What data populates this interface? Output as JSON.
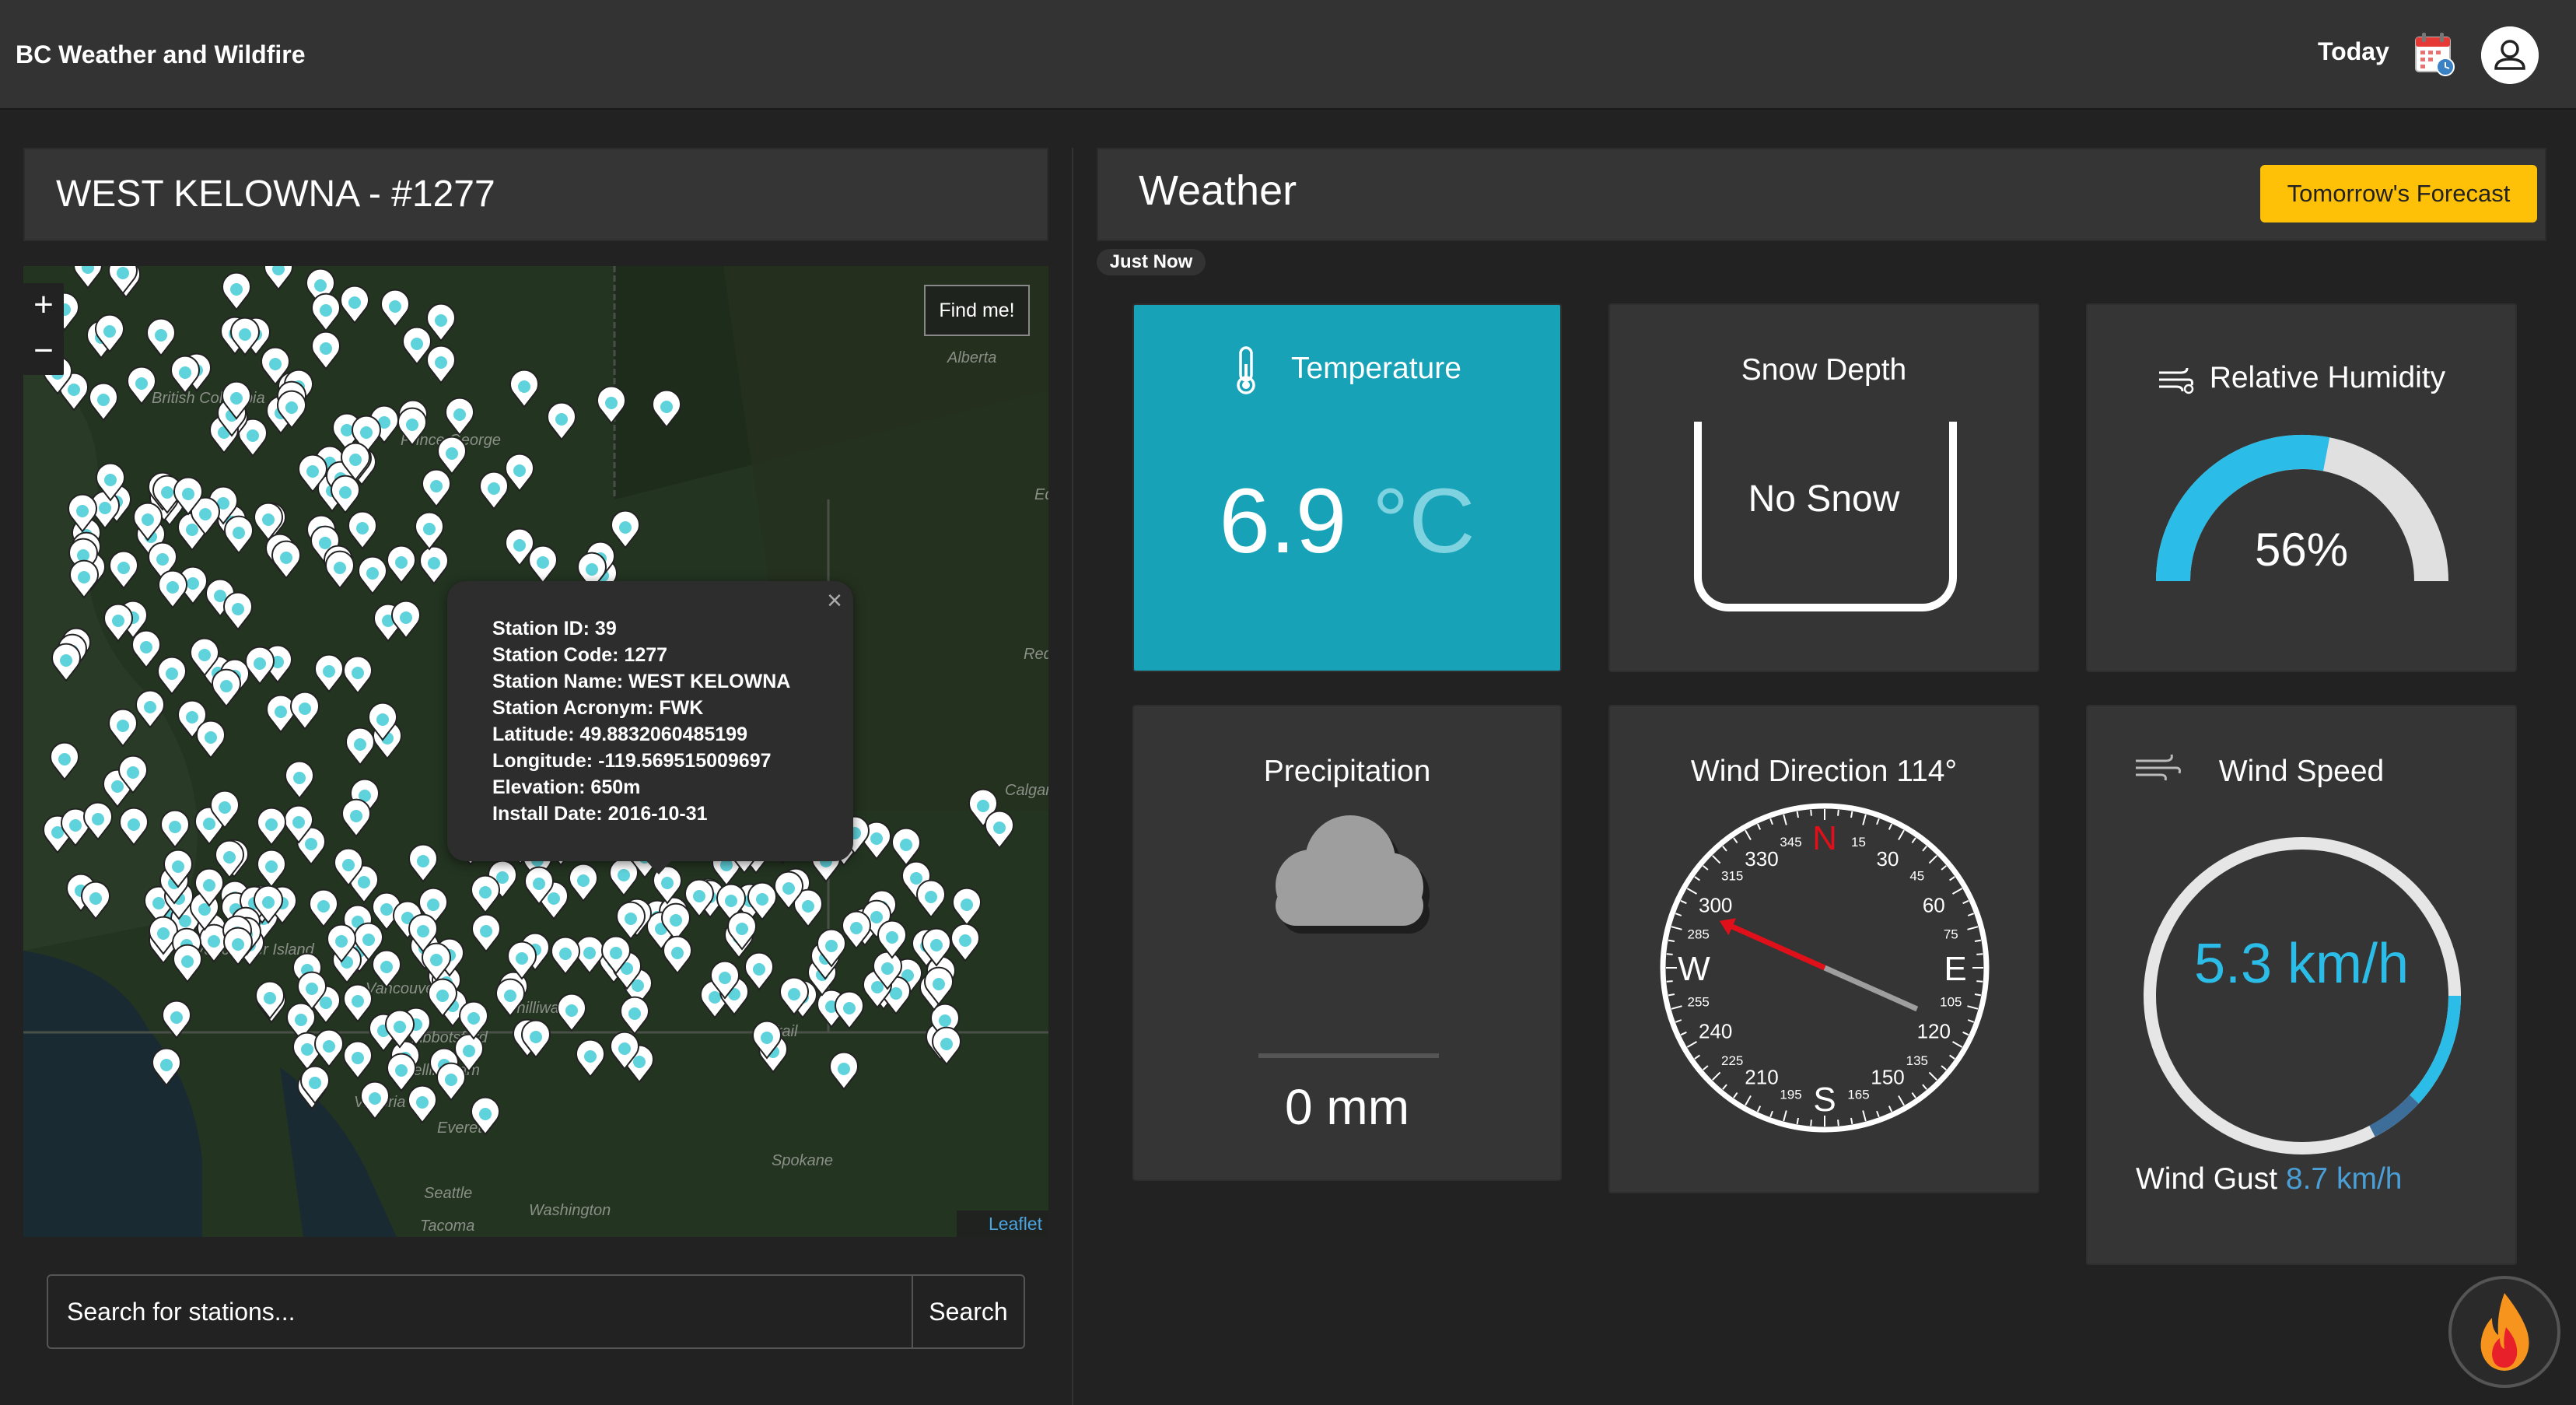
{
  "app": {
    "title": "BC Weather and Wildfire",
    "today_label": "Today"
  },
  "station": {
    "header": "WEST KELOWNA - #1277",
    "popup": {
      "lines": [
        "Station ID: 39",
        "Station Code: 1277",
        "Station Name: WEST KELOWNA",
        "Station Acronym: FWK",
        "Latitude: 49.8832060485199",
        "Longitude: -119.569515009697",
        "Elevation: 650m",
        "Install Date: 2016-10-31"
      ],
      "close": "×"
    }
  },
  "map": {
    "zoom_in": "+",
    "zoom_out": "−",
    "find_me": "Find me!",
    "attribution": "Leaflet",
    "places": [
      "Alberta",
      "British Columbia",
      "Prince George",
      "Abbotsford",
      "Bellingham",
      "Victoria",
      "Everett",
      "Seattle",
      "Tacoma",
      "Washington",
      "Spokane",
      "Trail",
      "Calgary",
      "Chilliwack",
      "Vancouver Island",
      "Vancouver",
      "Edmonton",
      "Red Deer"
    ]
  },
  "search": {
    "placeholder": "Search for stations...",
    "button": "Search"
  },
  "weather": {
    "title": "Weather",
    "forecast_button": "Tomorrow's Forecast",
    "timestamp_badge": "Just Now",
    "temperature": {
      "title": "Temperature",
      "value": "6.9",
      "unit": "°C"
    },
    "snow_depth": {
      "title": "Snow Depth",
      "value": "No Snow"
    },
    "humidity": {
      "title": "Relative Humidity",
      "value": "56%",
      "percent": 56
    },
    "precipitation": {
      "title": "Precipitation",
      "value": "0 mm"
    },
    "wind_direction": {
      "title": "Wind Direction 114°",
      "degrees": 114,
      "cardinals": [
        "N",
        "E",
        "S",
        "W"
      ],
      "major_ticks": [
        "30",
        "60",
        "120",
        "150",
        "210",
        "240",
        "300",
        "330"
      ],
      "minor_ticks": [
        "15",
        "45",
        "75",
        "105",
        "135",
        "165",
        "195",
        "225",
        "255",
        "285",
        "315",
        "345"
      ]
    },
    "wind_speed": {
      "title": "Wind Speed",
      "value": "5.3 km/h",
      "gust_label": "Wind Gust",
      "gust_value": "8.7 km/h"
    }
  },
  "colors": {
    "accent": "#17a2b8",
    "warning": "#ffc107",
    "speed": "#2bbde8",
    "north": "#e0101a"
  }
}
